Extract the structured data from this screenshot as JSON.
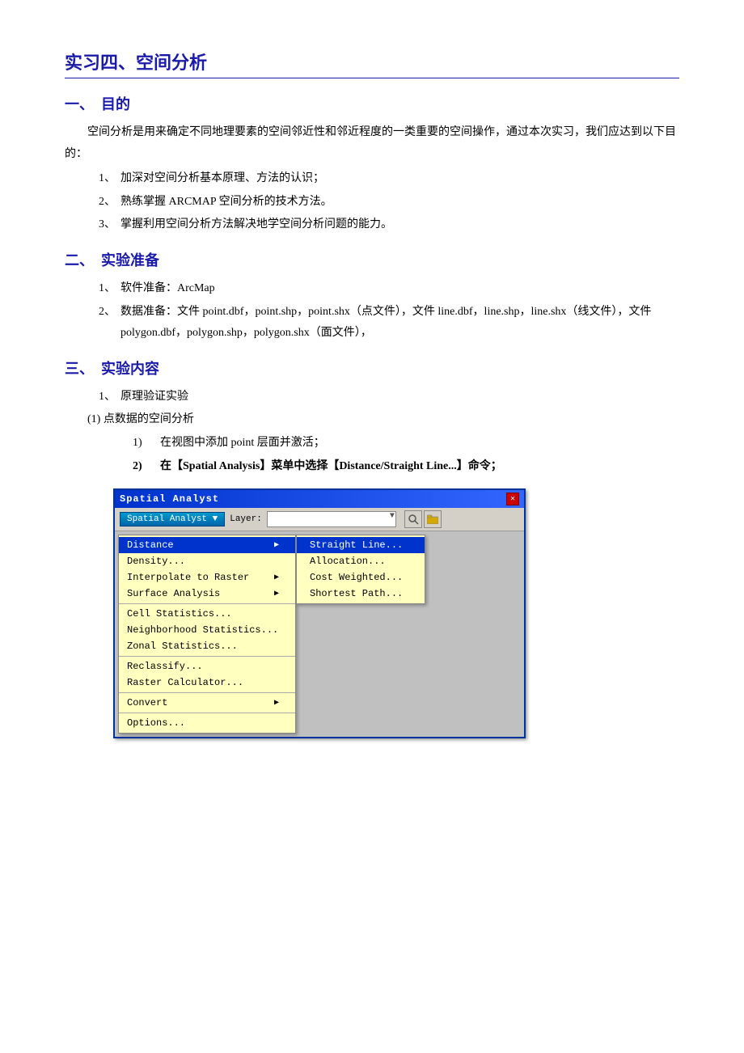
{
  "page": {
    "title": "实习四、空间分析",
    "sections": [
      {
        "id": "section1",
        "title": "一、　目的",
        "intro": "空间分析是用来确定不同地理要素的空间邻近性和邻近程度的一类重要的空间操作，通过本次实习，我们应达到以下目的：",
        "items": [
          {
            "num": "1、",
            "text": "加深对空间分析基本原理、方法的认识；"
          },
          {
            "num": "2、",
            "text": "熟练掌握 ARCMAP 空间分析的技术方法。"
          },
          {
            "num": "3、",
            "text": "掌握利用空间分析方法解决地学空间分析问题的能力。"
          }
        ]
      },
      {
        "id": "section2",
        "title": "二、　实验准备",
        "items": [
          {
            "num": "1、",
            "text": "软件准备：ArcMap"
          },
          {
            "num": "2、",
            "text": "数据准备：文件 point.dbf，point.shp，point.shx（点文件），文件 line.dbf，line.shp，line.shx（线文件），文件 polygon.dbf，polygon.shp，polygon.shx（面文件），"
          }
        ]
      },
      {
        "id": "section3",
        "title": "三、　实验内容",
        "items": [
          {
            "num": "1、",
            "text": "原理验证实验"
          }
        ],
        "sub": {
          "label": "(1) 点数据的空间分析",
          "steps": [
            {
              "num": "1)",
              "text": "在视图中添加 point 层面并激活；",
              "bold": false
            },
            {
              "num": "2)",
              "text": "在【Spatial Analysis】菜单中选择【Distance/Straight Line...】命令；",
              "bold": true
            }
          ]
        }
      }
    ]
  },
  "arcgis_window": {
    "title": "Spatial Analyst",
    "close_label": "✕",
    "toolbar": {
      "btn_label": "Spatial Analyst ▼",
      "layer_label": "Layer:",
      "layer_placeholder": ""
    },
    "menu": {
      "items": [
        {
          "label": "Distance",
          "has_arrow": true,
          "highlighted": true
        },
        {
          "label": "Density...",
          "has_arrow": false,
          "highlighted": false
        },
        {
          "label": "Interpolate to Raster",
          "has_arrow": true,
          "highlighted": false
        },
        {
          "label": "Surface Analysis",
          "has_arrow": true,
          "highlighted": false
        },
        {
          "divider_before": true,
          "label": "Cell Statistics...",
          "has_arrow": false,
          "highlighted": false
        },
        {
          "label": "Neighborhood Statistics...",
          "has_arrow": false,
          "highlighted": false
        },
        {
          "label": "Zonal Statistics...",
          "has_arrow": false,
          "highlighted": false
        },
        {
          "divider_before": true,
          "label": "Reclassify...",
          "has_arrow": false,
          "highlighted": false
        },
        {
          "label": "Raster Calculator...",
          "has_arrow": false,
          "highlighted": false
        },
        {
          "divider_before": true,
          "label": "Convert",
          "has_arrow": true,
          "highlighted": false
        },
        {
          "divider_before": true,
          "label": "Options...",
          "has_arrow": false,
          "highlighted": false
        }
      ],
      "submenu_items": [
        {
          "label": "Straight Line...",
          "highlighted": true
        },
        {
          "label": "Allocation...",
          "highlighted": false
        },
        {
          "label": "Cost Weighted...",
          "highlighted": false
        },
        {
          "label": "Shortest Path...",
          "highlighted": false
        }
      ]
    }
  }
}
